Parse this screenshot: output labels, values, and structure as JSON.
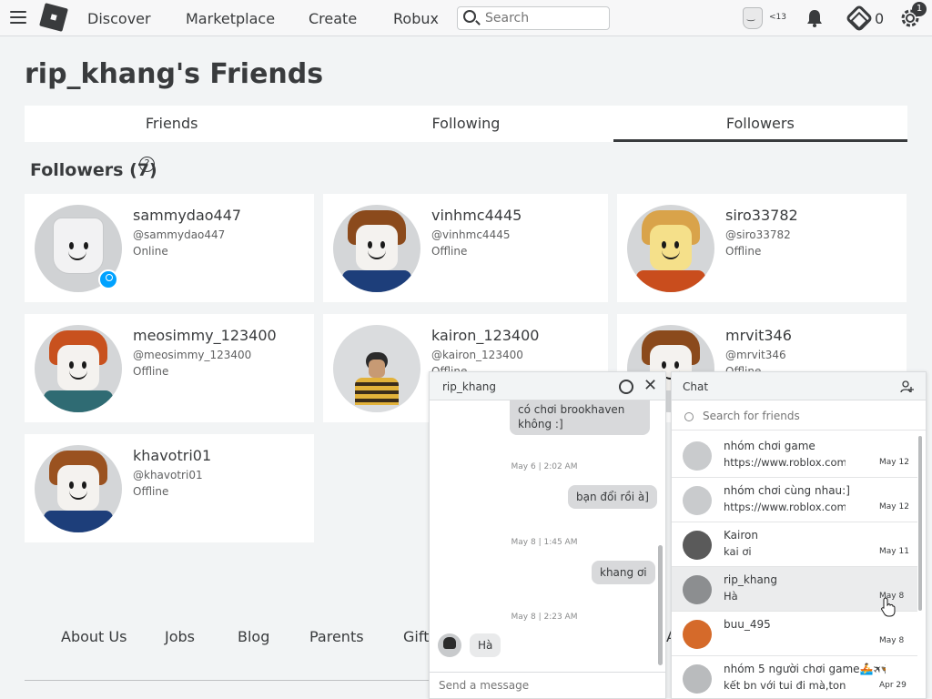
{
  "nav": {
    "links": [
      "Discover",
      "Marketplace",
      "Create",
      "Robux"
    ],
    "search_placeholder": "Search",
    "age_tag": "<13",
    "robux_count": "0",
    "settings_badge": "1"
  },
  "page": {
    "title": "rip_khang's Friends",
    "tabs": [
      "Friends",
      "Following",
      "Followers"
    ],
    "active_tab": "Followers",
    "section_title": "Followers (7)",
    "help_glyph": "?"
  },
  "followers": [
    {
      "name": "sammydao447",
      "handle": "@sammydao447",
      "status": "Online"
    },
    {
      "name": "vinhmc4445",
      "handle": "@vinhmc4445",
      "status": "Offline"
    },
    {
      "name": "siro33782",
      "handle": "@siro33782",
      "status": "Offline"
    },
    {
      "name": "meosimmy_123400",
      "handle": "@meosimmy_123400",
      "status": "Offline"
    },
    {
      "name": "kairon_123400",
      "handle": "@kairon_123400",
      "status": "Offline"
    },
    {
      "name": "mrvit346",
      "handle": "@mrvit346",
      "status": "Offline"
    },
    {
      "name": "khavotri01",
      "handle": "@khavotri01",
      "status": "Offline"
    }
  ],
  "footer": {
    "links": [
      "About Us",
      "Jobs",
      "Blog",
      "Parents",
      "Gift",
      "A"
    ]
  },
  "conversation": {
    "title": "rip_khang",
    "messages": [
      {
        "text": "có chơi brookhaven",
        "text2": "không :]"
      },
      {
        "ts": "May 6 | 2:02 AM"
      },
      {
        "text": "bạn đổi rồi à]"
      },
      {
        "ts": "May 8 | 1:45 AM"
      },
      {
        "text": "khang ơi"
      },
      {
        "ts": "May 8 | 2:23 AM"
      },
      {
        "text": "Hà"
      }
    ],
    "input_placeholder": "Send a message"
  },
  "chat": {
    "title": "Chat",
    "search_placeholder": "Search for friends",
    "items": [
      {
        "name": "nhóm chơi game",
        "preview": "https://www.roblox.com/g",
        "date": "May 12"
      },
      {
        "name": "nhóm chơi cùng nhau:]",
        "preview": "https://www.roblox.com/g",
        "date": "May 12"
      },
      {
        "name": "Kairon",
        "preview": "kai ơi",
        "date": "May 11"
      },
      {
        "name": "rip_khang",
        "preview": "Hà",
        "date": "May 8"
      },
      {
        "name": "buu_495",
        "preview": "",
        "date": "May 8"
      },
      {
        "name": "nhóm 5 người chơi game🚣🛪🦋🌙",
        "preview": "kết bn với tui đi mà,tong",
        "date": "Apr 29"
      }
    ]
  }
}
